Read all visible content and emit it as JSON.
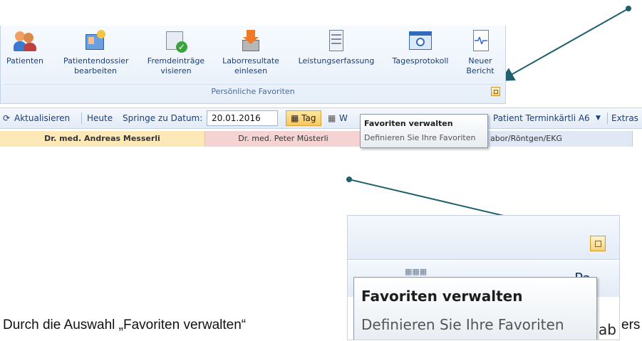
{
  "ribbon": {
    "buttons": [
      {
        "label1": "Patienten",
        "label2": "",
        "icon": "patients-icon"
      },
      {
        "label1": "Patientendossier",
        "label2": "bearbeiten",
        "icon": "dossier-icon"
      },
      {
        "label1": "Fremdeinträge",
        "label2": "visieren",
        "icon": "approve-entries-icon"
      },
      {
        "label1": "Laborresultate",
        "label2": "einlesen",
        "icon": "lab-import-icon"
      },
      {
        "label1": "Leistungserfassung",
        "label2": "",
        "icon": "service-entry-icon"
      },
      {
        "label1": "Tagesprotokoll",
        "label2": "",
        "icon": "day-protocol-icon"
      },
      {
        "label1": "Neuer",
        "label2": "Bericht",
        "icon": "new-report-icon"
      }
    ],
    "group_label": "Persönliche Favoriten"
  },
  "toolbar": {
    "refresh": "Aktualisieren",
    "today": "Heute",
    "jump_label": "Springe zu Datum:",
    "date_value": "20.01.2016",
    "day": "Tag",
    "week_partial": "W",
    "patient_label": "Patient Terminkärtli A6",
    "extras": "Extras"
  },
  "doctors": {
    "d1": "Dr. med. Andreas Messerli",
    "d2": "Dr. med. Peter Müsterli",
    "d3": "abor/Röntgen/EKG"
  },
  "tooltip": {
    "title": "Favoriten verwalten",
    "desc": "Definieren Sie Ihre Favoriten"
  },
  "inset": {
    "partial_right": "Pa",
    "partial_ab": "ab"
  },
  "caption": {
    "text": "Durch die Auswahl „Favoriten verwalten“",
    "tail": "ers"
  },
  "colors": {
    "arrow": "#1f5f6e",
    "doctor1_bg": "#fde9b7",
    "doctor2_bg": "#f6d3d3",
    "doctor3_bg": "#dfe8f4"
  }
}
